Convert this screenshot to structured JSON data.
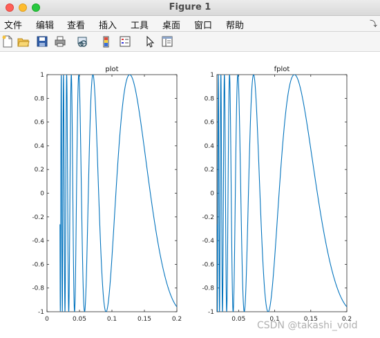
{
  "window": {
    "title": "Figure 1"
  },
  "menu": {
    "items": [
      "文件",
      "编辑",
      "查看",
      "插入",
      "工具",
      "桌面",
      "窗口",
      "帮助"
    ]
  },
  "toolbar": {
    "icons": [
      "new-figure-icon",
      "open-file-icon",
      "save-icon",
      "print-icon",
      "link-icon",
      "colorbar-icon",
      "legend-icon",
      "pointer-icon",
      "property-inspector-icon"
    ]
  },
  "watermark": "CSDN @takashi_void",
  "chart_data": [
    {
      "type": "line",
      "title": "plot",
      "function": "sin(1/x)",
      "xlim": [
        0,
        0.2
      ],
      "ylim": [
        -1,
        1
      ],
      "xticks": [
        "0",
        "0.05",
        "0.1",
        "0.15",
        "0.2"
      ],
      "yticks": [
        "1",
        "0.8",
        "0.6",
        "0.4",
        "0.2",
        "0",
        "-0.2",
        "-0.4",
        "-0.6",
        "-0.8",
        "-1"
      ],
      "series": [
        {
          "color": "#0072bd",
          "x_range": [
            0.02,
            0.2
          ],
          "sample_step": 0.01
        }
      ]
    },
    {
      "type": "line",
      "title": "fplot",
      "function": "sin(1/x)",
      "xlim": [
        0.02,
        0.2
      ],
      "ylim": [
        -1,
        1
      ],
      "xticks": [
        "0.05",
        "0.1",
        "0.15",
        "0.2"
      ],
      "yticks": [
        "1",
        "0.8",
        "0.6",
        "0.4",
        "0.2",
        "0",
        "-0.2",
        "-0.4",
        "-0.6",
        "-0.8",
        "-1"
      ],
      "series": [
        {
          "color": "#0072bd",
          "x_range": [
            0.02,
            0.2
          ],
          "sample_step": "adaptive"
        }
      ]
    }
  ]
}
